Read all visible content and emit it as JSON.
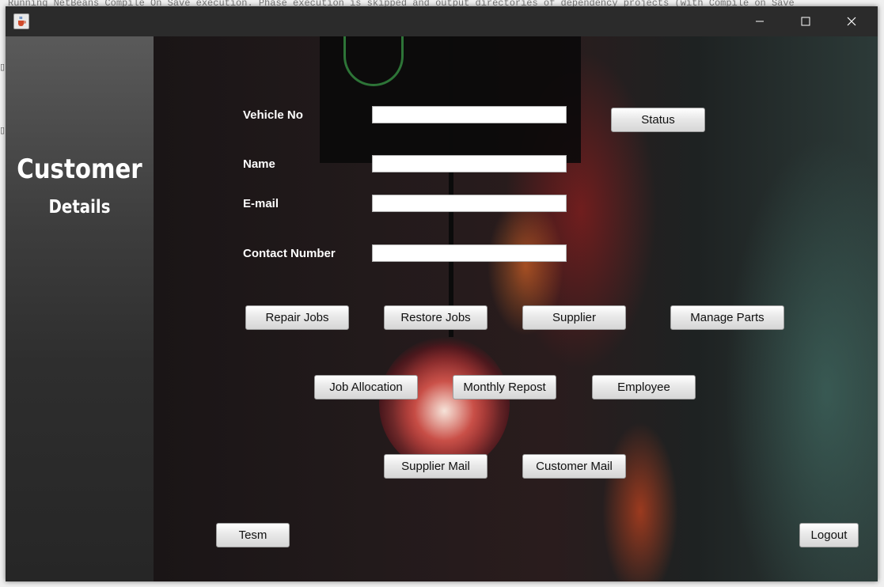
{
  "background_ide_text": "Running NetBeans Compile On Save execution. Phase execution is skipped and output directories of dependency projects (with Compile on Save",
  "window": {
    "title": "",
    "controls": {
      "minimize": "—",
      "maximize": "☐",
      "close": "✕"
    }
  },
  "sidebar": {
    "title_line1": "Customer",
    "title_line2": "Details"
  },
  "form": {
    "vehicle_no_label": "Vehicle No",
    "name_label": "Name",
    "email_label": "E-mail",
    "contact_label": "Contact Number",
    "vehicle_no_value": "",
    "name_value": "",
    "email_value": "",
    "contact_value": ""
  },
  "buttons": {
    "status": "Status",
    "repair_jobs": "Repair Jobs",
    "restore_jobs": "Restore Jobs",
    "supplier": "Supplier",
    "manage_parts": "Manage Parts",
    "job_allocation": "Job Allocation",
    "monthly_report": "Monthly Repost",
    "employee": "Employee",
    "supplier_mail": "Supplier Mail",
    "customer_mail": "Customer Mail",
    "tesm": "Tesm",
    "logout": "Logout"
  },
  "icons": {
    "app": "java-cup-icon"
  }
}
